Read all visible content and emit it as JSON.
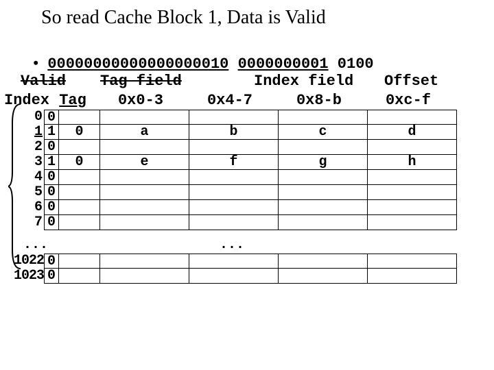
{
  "title": "So read Cache Block 1, Data is Valid",
  "bits": {
    "bullet": "•",
    "tag": "00000000000000000010",
    "index": "0000000001",
    "offset": "0100"
  },
  "field_labels": {
    "tag": "Tag field",
    "index": "Index field",
    "offset": "Offset",
    "valid": "Valid"
  },
  "headers": {
    "index": "Index",
    "tag": "Tag",
    "c0": "0x0-3",
    "c1": "0x4-7",
    "c2": "0x8-b",
    "c3": "0xc-f"
  },
  "rows": [
    {
      "idx": "0",
      "v": "0",
      "tag": "",
      "d": [
        "",
        "",
        "",
        ""
      ],
      "u": false
    },
    {
      "idx": "1",
      "v": "1",
      "tag": "0",
      "d": [
        "a",
        "b",
        "c",
        "d"
      ],
      "u": true
    },
    {
      "idx": "2",
      "v": "0",
      "tag": "",
      "d": [
        "",
        "",
        "",
        ""
      ],
      "u": false
    },
    {
      "idx": "3",
      "v": "1",
      "tag": "0",
      "d": [
        "e",
        "f",
        "g",
        "h"
      ],
      "u": false
    },
    {
      "idx": "4",
      "v": "0",
      "tag": "",
      "d": [
        "",
        "",
        "",
        ""
      ],
      "u": false
    },
    {
      "idx": "5",
      "v": "0",
      "tag": "",
      "d": [
        "",
        "",
        "",
        ""
      ],
      "u": false
    },
    {
      "idx": "6",
      "v": "0",
      "tag": "",
      "d": [
        "",
        "",
        "",
        ""
      ],
      "u": false
    },
    {
      "idx": "7",
      "v": "0",
      "tag": "",
      "d": [
        "",
        "",
        "",
        ""
      ],
      "u": false
    }
  ],
  "tail_rows": [
    {
      "idx": "1022",
      "v": "0",
      "tag": "",
      "d": [
        "",
        "",
        "",
        ""
      ]
    },
    {
      "idx": "1023",
      "v": "0",
      "tag": "",
      "d": [
        "",
        "",
        "",
        ""
      ]
    }
  ],
  "dots": "..."
}
